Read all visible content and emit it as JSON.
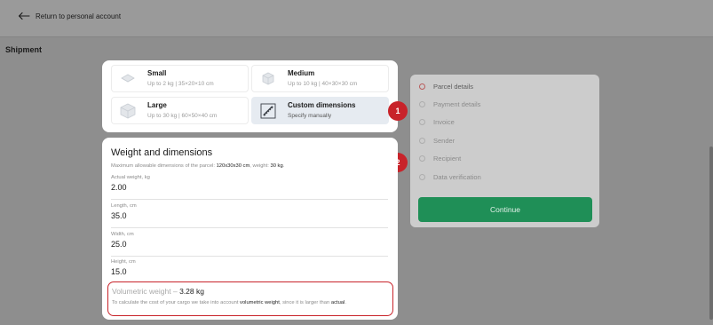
{
  "header": {
    "back_label": "Return to personal account"
  },
  "page": {
    "title": "Shipment"
  },
  "options": [
    {
      "title": "Small",
      "subtitle": "Up to 2 kg | 35×20×10 cm",
      "selected": false,
      "icon": "envelope-icon"
    },
    {
      "title": "Medium",
      "subtitle": "Up to 10 kg | 40×30×30 cm",
      "selected": false,
      "icon": "box-icon"
    },
    {
      "title": "Large",
      "subtitle": "Up to 30 kg | 60×50×40 cm",
      "selected": false,
      "icon": "large-box-icon"
    },
    {
      "title": "Custom dimensions",
      "subtitle": "Specify manually",
      "selected": true,
      "icon": "ruler-icon"
    }
  ],
  "badges": {
    "one": "1",
    "two": "2"
  },
  "weight": {
    "title": "Weight and dimensions",
    "note_prefix": "Maximum allowable dimensions of the parcel: ",
    "note_dims": "120x30x30 cm",
    "note_mid": ", weight: ",
    "note_weight": "30 kg",
    "note_suffix": ".",
    "fields": [
      {
        "label": "Actual weight, kg",
        "value": "2.00"
      },
      {
        "label": "Length, cm",
        "value": "35.0"
      },
      {
        "label": "Width, cm",
        "value": "25.0"
      },
      {
        "label": "Height, cm",
        "value": "15.0"
      }
    ],
    "volumetric_label": "Volumetric weight –",
    "volumetric_value": "3.28 kg",
    "vol_text_1": "To calculate the cost of your cargo we take into account ",
    "vol_text_bold": "volumetric weight",
    "vol_text_2": ", since it is larger than ",
    "vol_text_bold2": "actual",
    "vol_text_3": "."
  },
  "steps": [
    {
      "label": "Parcel details",
      "active": true
    },
    {
      "label": "Payment details",
      "active": false
    },
    {
      "label": "Invoice",
      "active": false
    },
    {
      "label": "Sender",
      "active": false
    },
    {
      "label": "Recipient",
      "active": false
    },
    {
      "label": "Data verification",
      "active": false
    }
  ],
  "continue_label": "Continue",
  "colors": {
    "accent_green": "#1f8f57",
    "badge_red": "#c8232a"
  }
}
